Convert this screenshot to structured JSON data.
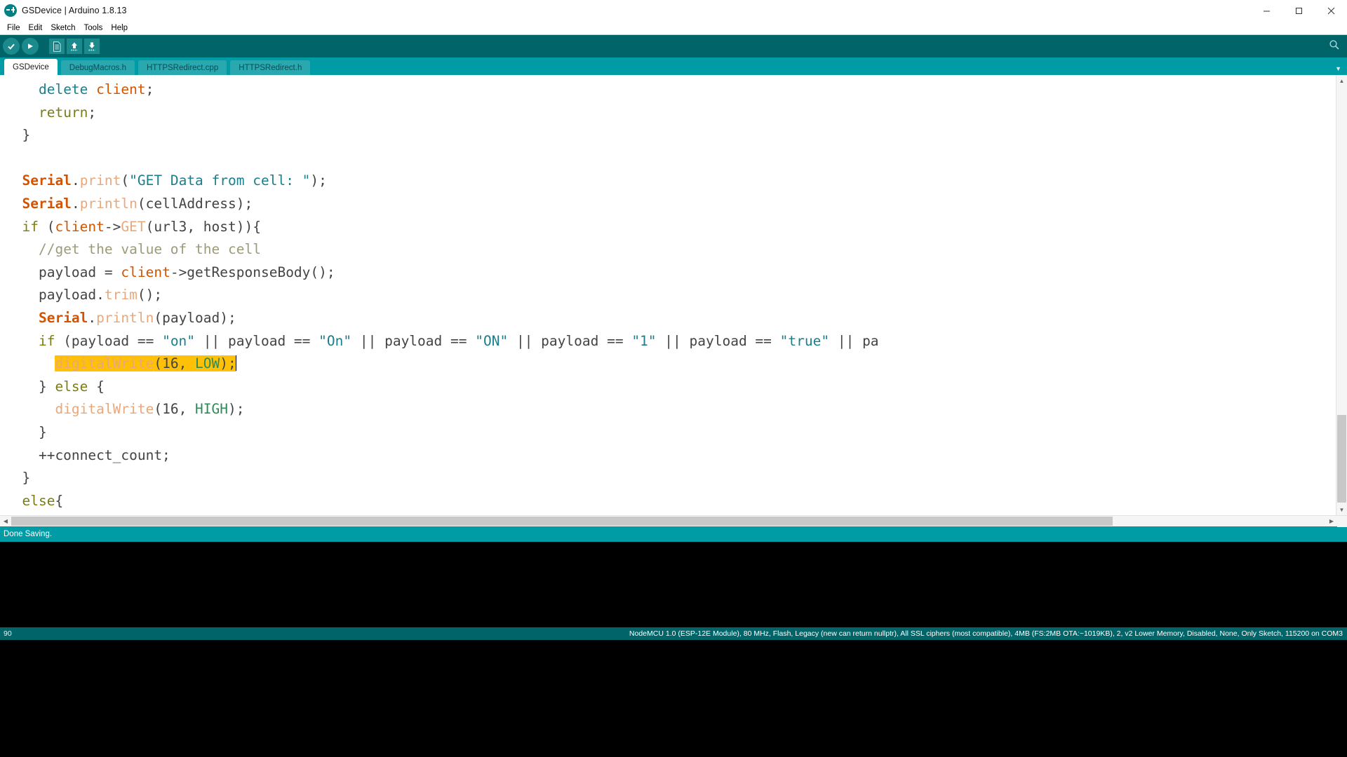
{
  "window": {
    "title": "GSDevice | Arduino 1.8.13",
    "app_icon": "arduino-infinity-icon",
    "controls": {
      "minimize": "minimize-icon",
      "maximize": "maximize-icon",
      "close": "close-icon"
    }
  },
  "menubar": {
    "items": [
      {
        "label": "File"
      },
      {
        "label": "Edit"
      },
      {
        "label": "Sketch"
      },
      {
        "label": "Tools"
      },
      {
        "label": "Help"
      }
    ]
  },
  "toolbar": {
    "buttons": [
      {
        "name": "verify-button",
        "icon": "check-icon",
        "tooltip": "Verify"
      },
      {
        "name": "upload-button",
        "icon": "arrow-right-icon",
        "tooltip": "Upload"
      },
      {
        "name": "new-button",
        "icon": "new-file-icon",
        "tooltip": "New"
      },
      {
        "name": "open-button",
        "icon": "arrow-up-icon",
        "tooltip": "Open"
      },
      {
        "name": "save-button",
        "icon": "arrow-down-icon",
        "tooltip": "Save"
      }
    ],
    "serial_monitor": {
      "name": "serial-monitor-button",
      "icon": "magnifier-icon"
    }
  },
  "tabs": {
    "items": [
      {
        "label": "GSDevice",
        "active": true
      },
      {
        "label": "DebugMacros.h",
        "active": false
      },
      {
        "label": "HTTPSRedirect.cpp",
        "active": false
      },
      {
        "label": "HTTPSRedirect.h",
        "active": false
      }
    ],
    "overflow_icon": "chevron-down-icon"
  },
  "editor": {
    "lines": [
      {
        "id": "l1",
        "segments": [
          {
            "t": "    ",
            "c": "plain"
          },
          {
            "t": "delete",
            "c": "kw2"
          },
          {
            "t": " client",
            "c": "fn"
          },
          {
            "t": ";",
            "c": "plain"
          }
        ]
      },
      {
        "id": "l2",
        "segments": [
          {
            "t": "    ",
            "c": "plain"
          },
          {
            "t": "return",
            "c": "kw"
          },
          {
            "t": ";",
            "c": "plain"
          }
        ]
      },
      {
        "id": "l3",
        "segments": [
          {
            "t": "  }",
            "c": "plain"
          }
        ]
      },
      {
        "id": "l4",
        "segments": [
          {
            "t": "",
            "c": "plain"
          }
        ]
      },
      {
        "id": "l5",
        "segments": [
          {
            "t": "  ",
            "c": "plain"
          },
          {
            "t": "Serial",
            "c": "obj"
          },
          {
            "t": ".",
            "c": "plain"
          },
          {
            "t": "print",
            "c": "fn-l"
          },
          {
            "t": "(",
            "c": "plain"
          },
          {
            "t": "\"GET Data from cell: \"",
            "c": "str"
          },
          {
            "t": ");",
            "c": "plain"
          }
        ]
      },
      {
        "id": "l6",
        "segments": [
          {
            "t": "  ",
            "c": "plain"
          },
          {
            "t": "Serial",
            "c": "obj"
          },
          {
            "t": ".",
            "c": "plain"
          },
          {
            "t": "println",
            "c": "fn-l"
          },
          {
            "t": "(cellAddress);",
            "c": "plain"
          }
        ]
      },
      {
        "id": "l7",
        "segments": [
          {
            "t": "  ",
            "c": "plain"
          },
          {
            "t": "if",
            "c": "kw"
          },
          {
            "t": " (",
            "c": "plain"
          },
          {
            "t": "client",
            "c": "fn"
          },
          {
            "t": "->",
            "c": "plain"
          },
          {
            "t": "GET",
            "c": "fn-l"
          },
          {
            "t": "(url3, host)){",
            "c": "plain"
          }
        ]
      },
      {
        "id": "l8",
        "segments": [
          {
            "t": "    ",
            "c": "plain"
          },
          {
            "t": "//get the value of the cell",
            "c": "cmt"
          }
        ]
      },
      {
        "id": "l9",
        "segments": [
          {
            "t": "    payload = ",
            "c": "plain"
          },
          {
            "t": "client",
            "c": "fn"
          },
          {
            "t": "->getResponseBody();",
            "c": "plain"
          }
        ]
      },
      {
        "id": "l10",
        "segments": [
          {
            "t": "    payload.",
            "c": "plain"
          },
          {
            "t": "trim",
            "c": "fn-l"
          },
          {
            "t": "();",
            "c": "plain"
          }
        ]
      },
      {
        "id": "l11",
        "segments": [
          {
            "t": "    ",
            "c": "plain"
          },
          {
            "t": "Serial",
            "c": "obj"
          },
          {
            "t": ".",
            "c": "plain"
          },
          {
            "t": "println",
            "c": "fn-l"
          },
          {
            "t": "(payload);",
            "c": "plain"
          }
        ]
      },
      {
        "id": "l12",
        "segments": [
          {
            "t": "    ",
            "c": "plain"
          },
          {
            "t": "if",
            "c": "kw"
          },
          {
            "t": " (payload == ",
            "c": "plain"
          },
          {
            "t": "\"on\"",
            "c": "str"
          },
          {
            "t": " || payload == ",
            "c": "plain"
          },
          {
            "t": "\"On\"",
            "c": "str"
          },
          {
            "t": " || payload == ",
            "c": "plain"
          },
          {
            "t": "\"ON\"",
            "c": "str"
          },
          {
            "t": " || payload == ",
            "c": "plain"
          },
          {
            "t": "\"1\"",
            "c": "str"
          },
          {
            "t": " || payload == ",
            "c": "plain"
          },
          {
            "t": "\"true\"",
            "c": "str"
          },
          {
            "t": " || pa",
            "c": "plain"
          }
        ]
      },
      {
        "id": "l13",
        "highlight": true,
        "segments": [
          {
            "t": "      ",
            "c": "plain"
          },
          {
            "t": "digitalWrite",
            "c": "fn-l",
            "hl": true
          },
          {
            "t": "(16, ",
            "c": "plain",
            "hl": true
          },
          {
            "t": "LOW",
            "c": "const",
            "hl": true
          },
          {
            "t": ");",
            "c": "plain",
            "hl": true
          }
        ]
      },
      {
        "id": "l14",
        "segments": [
          {
            "t": "    } ",
            "c": "plain"
          },
          {
            "t": "else",
            "c": "kw"
          },
          {
            "t": " {",
            "c": "plain"
          }
        ]
      },
      {
        "id": "l15",
        "segments": [
          {
            "t": "      ",
            "c": "plain"
          },
          {
            "t": "digitalWrite",
            "c": "fn-l"
          },
          {
            "t": "(16, ",
            "c": "plain"
          },
          {
            "t": "HIGH",
            "c": "const"
          },
          {
            "t": ");",
            "c": "plain"
          }
        ]
      },
      {
        "id": "l16",
        "segments": [
          {
            "t": "    }",
            "c": "plain"
          }
        ]
      },
      {
        "id": "l17",
        "segments": [
          {
            "t": "    ++connect_count;",
            "c": "plain"
          }
        ]
      },
      {
        "id": "l18",
        "segments": [
          {
            "t": "  }",
            "c": "plain"
          }
        ]
      },
      {
        "id": "l19",
        "segments": [
          {
            "t": "  ",
            "c": "plain"
          },
          {
            "t": "else",
            "c": "kw"
          },
          {
            "t": "{",
            "c": "plain"
          }
        ]
      }
    ]
  },
  "status": {
    "message": "Done Saving."
  },
  "console": {
    "output": ""
  },
  "footer": {
    "line_number": "90",
    "board_info": "NodeMCU 1.0 (ESP-12E Module), 80 MHz, Flash, Legacy (new can return nullptr), All SSL ciphers (most compatible), 4MB (FS:2MB OTA:~1019KB), 2, v2 Lower Memory, Disabled, None, Only Sketch, 115200 on COM3"
  },
  "colors": {
    "teal_dark": "#006468",
    "teal": "#009ca6",
    "highlight_yellow": "#ffc107",
    "keyword": "#7b7d14",
    "string": "#1a7e8c",
    "function": "#d35400",
    "comment": "#9b9b7a"
  }
}
